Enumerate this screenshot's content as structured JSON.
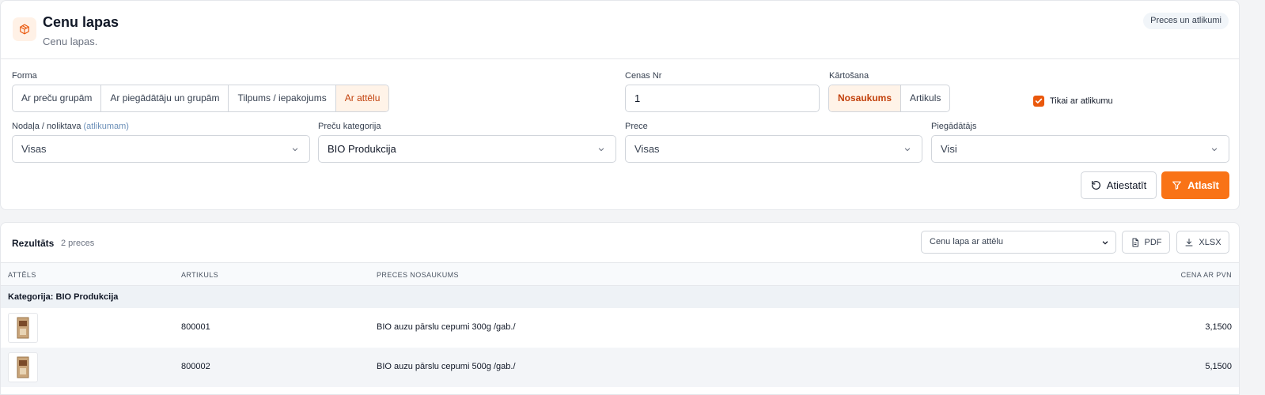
{
  "header": {
    "icon": "box-icon",
    "title": "Cenu lapas",
    "subtitle": "Cenu lapas.",
    "badge": "Preces un atlikumi"
  },
  "filters": {
    "forma": {
      "label": "Forma",
      "options": [
        "Ar preču grupām",
        "Ar piegādātāju un grupām",
        "Tilpums / iepakojums",
        "Ar attēlu"
      ],
      "selected": "Ar attēlu"
    },
    "cenas_nr": {
      "label": "Cenas Nr",
      "value": "1"
    },
    "sort": {
      "label": "Kārtošana",
      "options": [
        "Nosaukums",
        "Artikuls"
      ],
      "selected": "Nosaukums"
    },
    "only_stock": {
      "label": "Tikai ar atlikumu",
      "checked": true
    },
    "warehouse": {
      "label": "Nodaļa / noliktava",
      "hint": "(atlikumam)",
      "value": "Visas"
    },
    "category": {
      "label": "Preču kategorija",
      "value": "BIO Produkcija"
    },
    "product": {
      "label": "Prece",
      "value": "Visas"
    },
    "supplier": {
      "label": "Piegādātājs",
      "value": "Visi"
    },
    "reset_label": "Atiestatīt",
    "apply_label": "Atlasīt"
  },
  "results": {
    "title": "Rezultāts",
    "count": "2 preces",
    "format_select": "Cenu lapa ar attēlu",
    "pdf_label": "PDF",
    "xlsx_label": "XLSX",
    "columns": [
      "ATTĒLS",
      "ARTIKULS",
      "PRECES NOSAUKUMS",
      "CENA AR PVN"
    ],
    "category_row": "Kategorija: BIO Produkcija",
    "rows": [
      {
        "sku": "800001",
        "name": "BIO auzu pārslu cepumi 300g /gab./",
        "price": "3,1500"
      },
      {
        "sku": "800002",
        "name": "BIO auzu pārslu cepumi 500g /gab./",
        "price": "5,1500"
      }
    ]
  },
  "colors": {
    "accent": "#f97316",
    "accent_text": "#c2410c",
    "accent_bg": "#fff3e8"
  }
}
